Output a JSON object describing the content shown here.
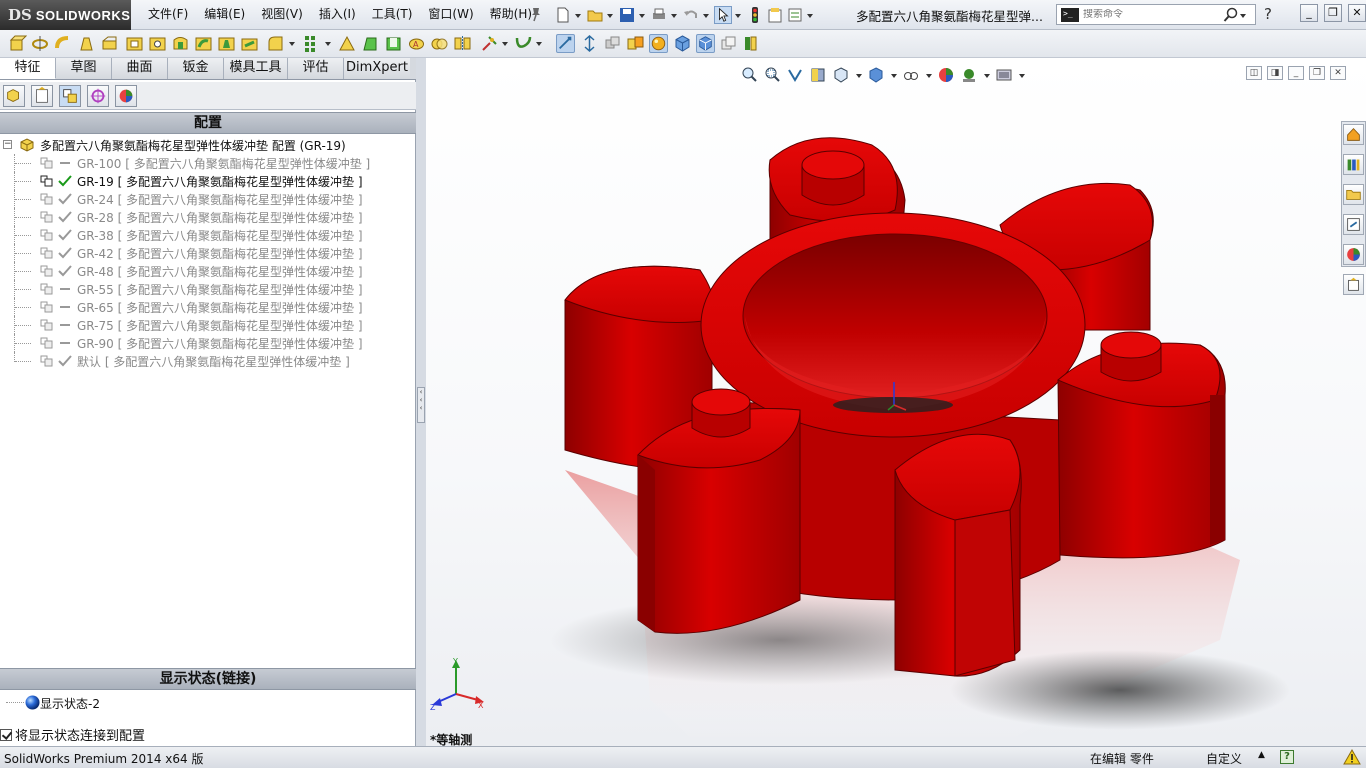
{
  "app": {
    "logo_text": "SOLIDWORKS",
    "logo_mark": "DS",
    "document_title": "多配置六八角聚氨酯梅花星型弹..."
  },
  "menu": [
    "文件(F)",
    "编辑(E)",
    "视图(V)",
    "插入(I)",
    "工具(T)",
    "窗口(W)",
    "帮助(H)"
  ],
  "search": {
    "placeholder": "搜索命令"
  },
  "tabs": [
    "特征",
    "草图",
    "曲面",
    "钣金",
    "模具工具",
    "评估",
    "DimXpert"
  ],
  "active_tab": "特征",
  "config_panel": {
    "header": "配置",
    "root_label": "多配置六八角聚氨酯梅花星型弹性体缓冲垫 配置  (GR-19)",
    "rows": [
      {
        "label": "GR-100 [ 多配置六八角聚氨酯梅花星型弹性体缓冲垫 ]",
        "status": "dash",
        "active": false
      },
      {
        "label": "GR-19 [ 多配置六八角聚氨酯梅花星型弹性体缓冲垫 ]",
        "status": "check-green",
        "active": true
      },
      {
        "label": "GR-24 [ 多配置六八角聚氨酯梅花星型弹性体缓冲垫 ]",
        "status": "check-grey",
        "active": false
      },
      {
        "label": "GR-28 [ 多配置六八角聚氨酯梅花星型弹性体缓冲垫 ]",
        "status": "check-grey",
        "active": false
      },
      {
        "label": "GR-38 [ 多配置六八角聚氨酯梅花星型弹性体缓冲垫 ]",
        "status": "check-grey",
        "active": false
      },
      {
        "label": "GR-42 [ 多配置六八角聚氨酯梅花星型弹性体缓冲垫 ]",
        "status": "check-grey",
        "active": false
      },
      {
        "label": "GR-48 [ 多配置六八角聚氨酯梅花星型弹性体缓冲垫 ]",
        "status": "check-grey",
        "active": false
      },
      {
        "label": "GR-55 [ 多配置六八角聚氨酯梅花星型弹性体缓冲垫 ]",
        "status": "dash",
        "active": false
      },
      {
        "label": "GR-65 [ 多配置六八角聚氨酯梅花星型弹性体缓冲垫 ]",
        "status": "dash",
        "active": false
      },
      {
        "label": "GR-75 [ 多配置六八角聚氨酯梅花星型弹性体缓冲垫 ]",
        "status": "dash",
        "active": false
      },
      {
        "label": "GR-90 [ 多配置六八角聚氨酯梅花星型弹性体缓冲垫 ]",
        "status": "dash",
        "active": false
      },
      {
        "label": "默认 [ 多配置六八角聚氨酯梅花星型弹性体缓冲垫 ]",
        "status": "check-grey",
        "active": false
      }
    ]
  },
  "display_state_panel": {
    "header": "显示状态(链接)",
    "item": "显示状态-2",
    "link_checkbox_label": "将显示状态连接到配置",
    "link_checked": true
  },
  "viewport": {
    "view_name": "*等轴测",
    "triad_labels": {
      "x": "X",
      "y": "Y",
      "z": "Z"
    },
    "model_color": "#d10000"
  },
  "statusbar": {
    "product": "SolidWorks Premium 2014 x64 版",
    "editing": "在编辑 零件",
    "units": "自定义",
    "help_label": "?"
  },
  "colors": {
    "active_check": "#1a9a1a",
    "inactive_text": "#8a8a8a",
    "section_header": "#b4bac4"
  }
}
